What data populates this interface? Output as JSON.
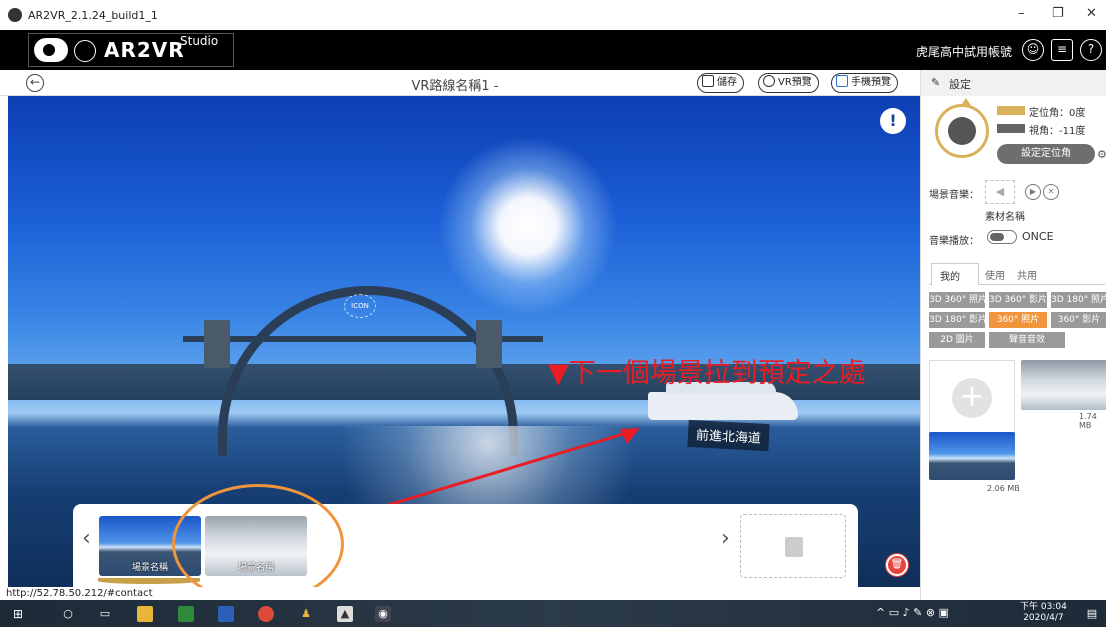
{
  "window": {
    "title": "AR2VR_2.1.24_build1_1",
    "minimize": "–",
    "restore": "❐",
    "close": "✕"
  },
  "header": {
    "brand": "AR2VR",
    "brand_sub": "Studio",
    "account": "虎尾高中試用帳號"
  },
  "toolbar": {
    "scene_title": "VR路線名稱1 -",
    "save": "儲存",
    "vr_preview": "VR預覽",
    "mobile_preview": "手機預覽"
  },
  "viewer": {
    "icon_label": "ICON",
    "overlay_text": "▼下一個場景拉到預定之處",
    "hotspot_label": "前進北海道",
    "info_mark": "!"
  },
  "scene_strip": {
    "prev": "‹",
    "next": "›",
    "scenes": [
      {
        "caption": "場景名稱"
      },
      {
        "caption": "場景名稱"
      }
    ]
  },
  "status_url": "http://52.78.50.212/#contact",
  "side_panel": {
    "header": "設定",
    "legend": [
      {
        "label": "定位角：0度",
        "color": "#d9b15a"
      },
      {
        "label": "視角：-11度",
        "color": "#666666"
      }
    ],
    "set_position": "設定定位角",
    "scene_music_label": "場景音樂：",
    "material_name": "素材名稱",
    "music_play_label": "音樂播放：",
    "music_mode": "ONCE",
    "tabs": [
      "我的",
      "使用",
      "共用"
    ],
    "filters": [
      "3D 360° 照片",
      "3D 360° 影片",
      "3D 180° 照片",
      "3D 180° 影片",
      "360° 照片",
      "360° 影片",
      "2D 圖片",
      "聲音音效"
    ],
    "active_filter": "360° 照片",
    "assets": [
      {
        "size": "1.74 MB"
      },
      {
        "size": "2.06 MB"
      }
    ]
  },
  "taskbar": {
    "clock_time": "下午 03:04",
    "clock_date": "2020/4/7"
  },
  "colors": {
    "accent_orange": "#f0953c",
    "accent_gold": "#d9b15a",
    "overlay_red": "#ea1c24"
  }
}
